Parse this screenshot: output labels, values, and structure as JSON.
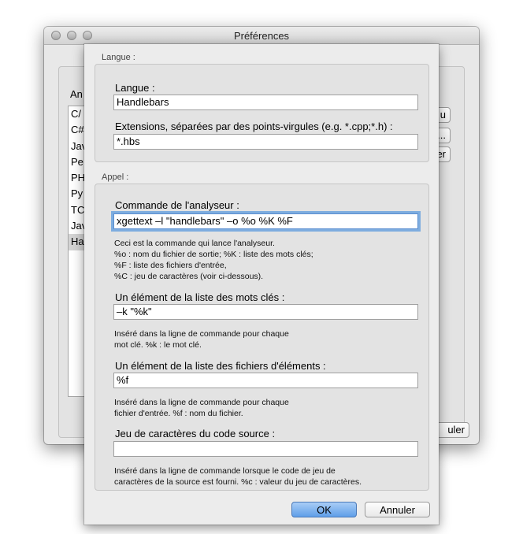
{
  "window": {
    "title": "Préférences"
  },
  "background": {
    "label": "An",
    "list_items": [
      "C/",
      "C#",
      "Jav",
      "Pe",
      "PH",
      "Py",
      "TC",
      "Jav",
      "Ha"
    ],
    "selected_index": 8,
    "buttons": [
      "u",
      "...",
      "er"
    ],
    "bottom_button": "uler"
  },
  "sheet": {
    "langue_group_label": "Langue :",
    "langue_label": "Langue :",
    "langue_value": "Handlebars",
    "extensions_label": "Extensions, séparées par des points-virgules (e.g. *.cpp;*.h) :",
    "extensions_value": "*.hbs",
    "appel_group_label": "Appel :",
    "command_label": "Commande de l'analyseur :",
    "command_value": "xgettext –l \"handlebars\" –o %o %K %F",
    "command_help": "Ceci est la commande qui lance l'analyseur.\n%o : nom du fichier de sortie; %K : liste des mots clés;\n%F : liste des fichiers d'entrée,\n%C : jeu de caractères (voir ci-dessous).",
    "keyword_label": "Un élément de la liste des mots clés :",
    "keyword_value": "–k \"%k\"",
    "keyword_help": "Inséré dans la ligne de commande pour chaque\nmot clé. %k : le mot clé.",
    "file_label": "Un élément de la liste des fichiers d'éléments :",
    "file_value": "%f",
    "file_help": "Inséré dans la ligne de commande pour chaque\nfichier d'entrée. %f : nom du fichier.",
    "charset_label": "Jeu de caractères du code source :",
    "charset_value": "",
    "charset_help": "Inséré dans la ligne de commande lorsque le code de jeu de\ncaractères de la source est fourni. %c : valeur du jeu de caractères.",
    "ok_label": "OK",
    "cancel_label": "Annuler"
  }
}
